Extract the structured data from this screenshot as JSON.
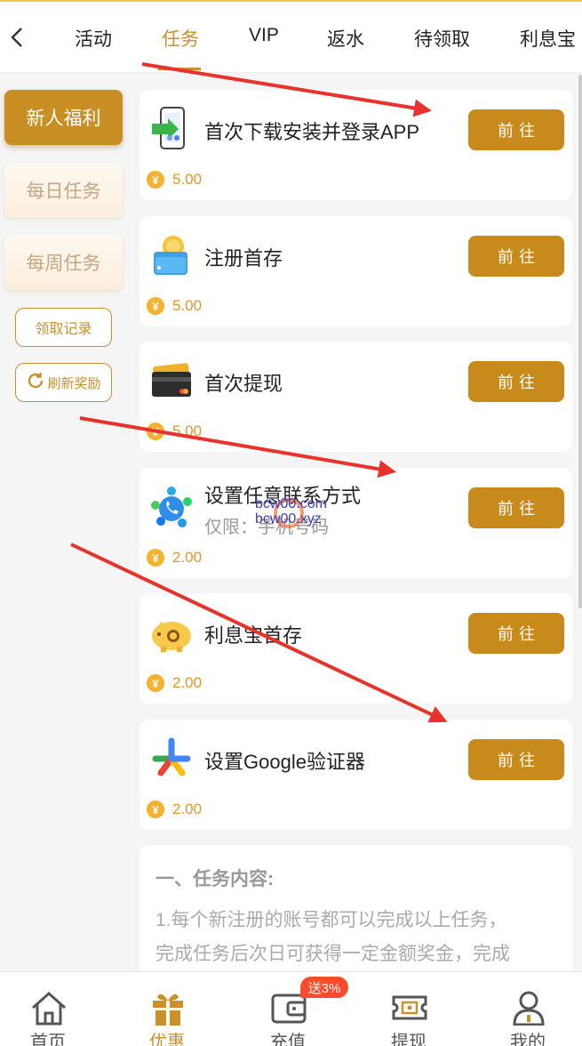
{
  "tabs": [
    {
      "label": "活动",
      "active": false
    },
    {
      "label": "任务",
      "active": true
    },
    {
      "label": "VIP",
      "active": false
    },
    {
      "label": "返水",
      "active": false
    },
    {
      "label": "待领取",
      "active": false
    },
    {
      "label": "利息宝",
      "active": false
    }
  ],
  "sidebar": {
    "items": [
      {
        "label": "新人福利",
        "active": true
      },
      {
        "label": "每日任务",
        "active": false
      },
      {
        "label": "每周任务",
        "active": false
      }
    ],
    "records_label": "领取记录",
    "refresh_label": "刷新奖励"
  },
  "tasks": [
    {
      "title": "首次下载安装并登录APP",
      "reward": "5.00",
      "button": "前往",
      "icon": "phone-download-icon"
    },
    {
      "title": "注册首存",
      "reward": "5.00",
      "button": "前往",
      "icon": "wallet-coin-icon"
    },
    {
      "title": "首次提现",
      "reward": "5.00",
      "button": "前往",
      "icon": "bank-card-icon"
    },
    {
      "title": "设置任意联系方式",
      "subtitle": "仅限：手机号码",
      "reward": "2.00",
      "button": "前往",
      "icon": "contact-apps-icon"
    },
    {
      "title": "利息宝首存",
      "reward": "2.00",
      "button": "前往",
      "icon": "piggy-bank-icon"
    },
    {
      "title": "设置Google验证器",
      "reward": "2.00",
      "button": "前往",
      "icon": "google-authenticator-icon"
    }
  ],
  "coin_symbol": "¥",
  "info": {
    "heading": "一、任务内容:",
    "line1": "1.每个新注册的账号都可以完成以上任务，",
    "line2": "完成任务后次日可获得一定金额奖金，完成"
  },
  "watermark": {
    "line1": "bcw00.com",
    "line2": "bcw00.xyz"
  },
  "bottom_nav": [
    {
      "label": "首页",
      "icon": "home-icon",
      "active": false
    },
    {
      "label": "优惠",
      "icon": "gift-icon",
      "active": true
    },
    {
      "label": "充值",
      "icon": "wallet-icon",
      "active": false
    },
    {
      "label": "提现",
      "icon": "ticket-icon",
      "active": false
    },
    {
      "label": "我的",
      "icon": "user-icon",
      "active": false
    }
  ],
  "recharge_badge": "送3%",
  "colors": {
    "accent": "#c98a1c",
    "coin": "#f3b230",
    "arrow": "#e8322c"
  }
}
